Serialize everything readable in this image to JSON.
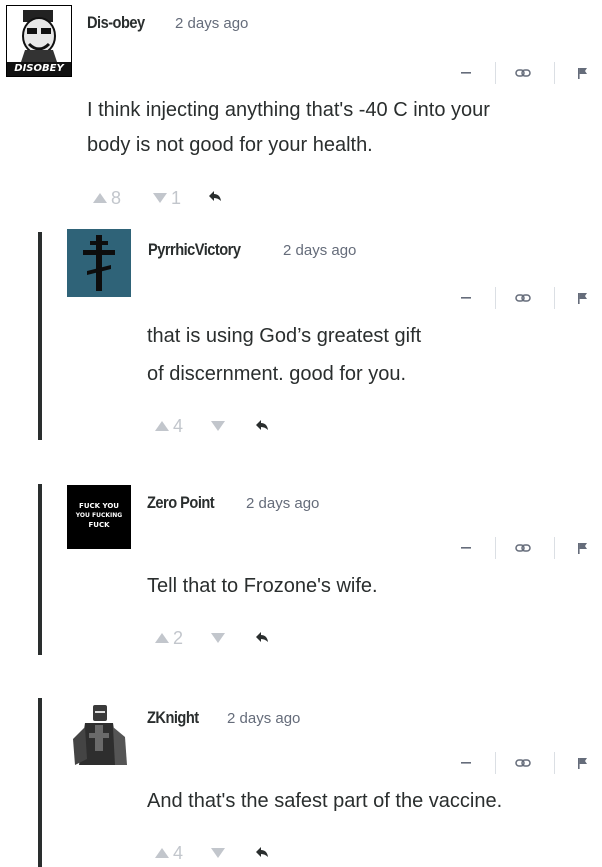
{
  "comments": [
    {
      "author": "Dis-obey",
      "time": "2 days ago",
      "avatar_label": "DISOBEY",
      "lines": [
        "I think injecting anything that's -40 C into your",
        "body is not good for your health."
      ],
      "upvotes": "8",
      "downvotes": "1"
    },
    {
      "author": "PyrrhicVictory",
      "time": "2 days ago",
      "lines": [
        "that is using God’s greatest gift",
        "of discernment. good for you."
      ],
      "upvotes": "4",
      "downvotes": ""
    },
    {
      "author": "Zero Point",
      "time": "2 days ago",
      "avatar_text": [
        "FUCK YOU",
        "YOU FUCKING",
        "FUCK"
      ],
      "lines": [
        "Tell that to Frozone's wife."
      ],
      "upvotes": "2",
      "downvotes": ""
    },
    {
      "author": "ZKnight",
      "time": "2 days ago",
      "lines": [
        "And that's the safest part of the vaccine."
      ],
      "upvotes": "4",
      "downvotes": ""
    }
  ],
  "icons": {
    "collapse": "minus-icon",
    "link": "link-icon",
    "flag": "flag-icon",
    "upvote": "triangle-up-icon",
    "downvote": "triangle-down-icon",
    "reply": "reply-arrow-icon"
  },
  "colors": {
    "text": "#2a2e2e",
    "meta": "#656c7a",
    "vote": "#c2c6cc",
    "thread_bar": "#2a2e2e",
    "avatar_teal": "#2f6378"
  }
}
